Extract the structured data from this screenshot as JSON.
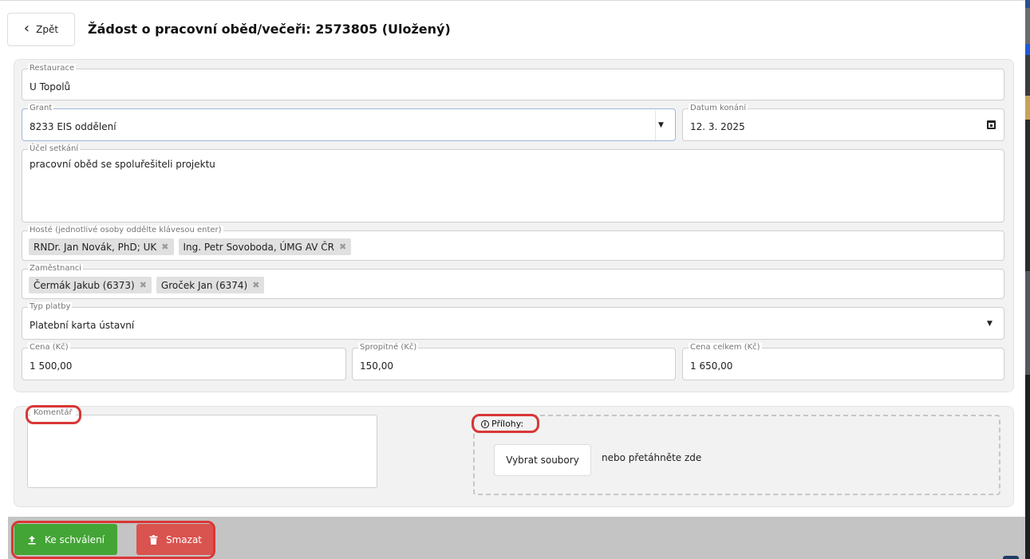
{
  "header": {
    "back_label": "Zpět",
    "title": "Žádost o pracovní oběd/večeři: 2573805 (Uložený)"
  },
  "form": {
    "restaurant": {
      "label": "Restaurace",
      "value": "U Topolů"
    },
    "grant": {
      "label": "Grant",
      "value": "8233 EIS oddělení"
    },
    "date": {
      "label": "Datum konání",
      "value": "12. 3. 2025"
    },
    "purpose": {
      "label": "Účel setkání",
      "value": "pracovní oběd se spoluřešiteli projektu"
    },
    "guests": {
      "label": "Hosté (jednotlivé osoby oddělte klávesou enter)",
      "chips": [
        "RNDr. Jan Novák, PhD; UK",
        "Ing. Petr Sovoboda, ÚMG AV ČR"
      ]
    },
    "employees": {
      "label": "Zaměstnanci",
      "chips": [
        "Čermák Jakub (6373)",
        "Groček Jan (6374)"
      ]
    },
    "payment": {
      "label": "Typ platby",
      "value": "Platební karta ústavní"
    },
    "price": {
      "label": "Cena (Kč)",
      "value": "1 500,00"
    },
    "tip": {
      "label": "Spropitné (Kč)",
      "value": "150,00"
    },
    "total": {
      "label": "Cena celkem (Kč)",
      "value": "1 650,00"
    }
  },
  "bottom": {
    "comment_label": "Komentář",
    "attachments_label": "Přílohy:",
    "pick_files": "Vybrat soubory",
    "drag_hint": "nebo přetáhněte zde"
  },
  "footer": {
    "submit_label": "Ke schválení",
    "delete_label": "Smazat"
  },
  "colors": {
    "submit": "#43a535",
    "delete": "#d9534f",
    "highlight": "#d93636"
  },
  "icons": {
    "back": "chevron-left-icon",
    "calendar": "calendar-icon",
    "dropdown": "caret-down-icon",
    "chip_remove": "close-icon",
    "info": "info-icon",
    "upload": "upload-icon",
    "trash": "trash-icon"
  }
}
